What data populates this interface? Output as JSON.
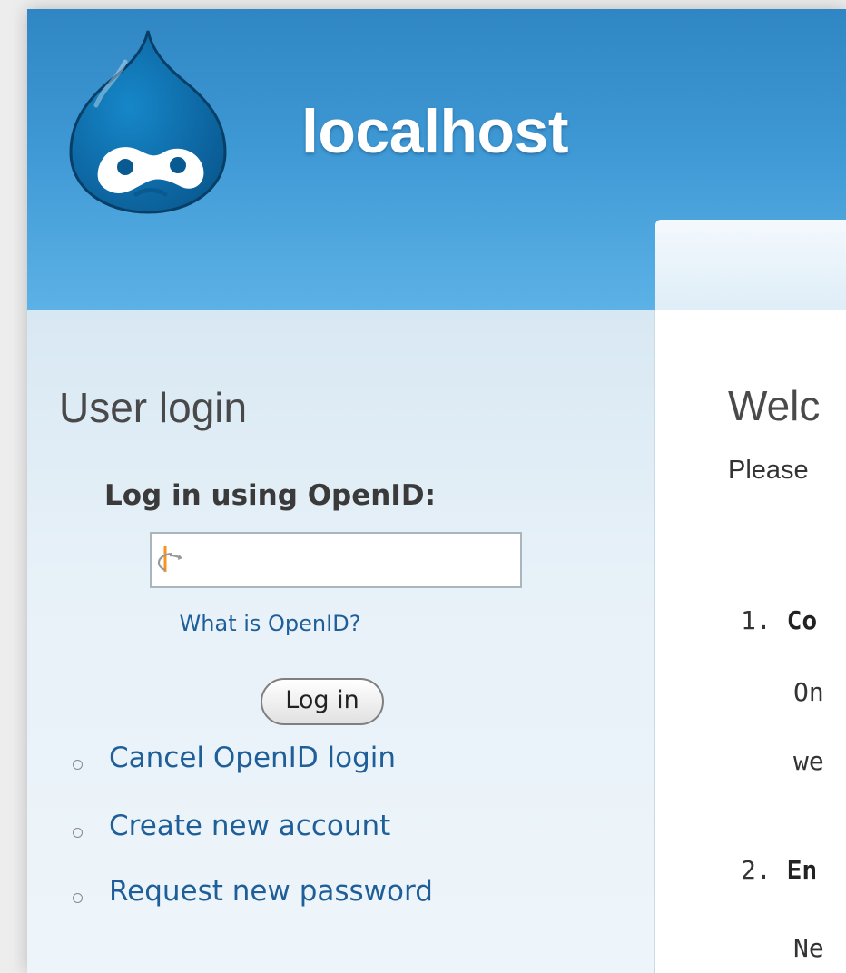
{
  "header": {
    "site_name": "localhost"
  },
  "sidebar": {
    "title": "User login",
    "openid_label": "Log in using OpenID:",
    "openid_value": "",
    "openid_help": "What is OpenID?",
    "login_button": "Log in",
    "links": [
      {
        "label": "Cancel OpenID login"
      },
      {
        "label": "Create new account"
      },
      {
        "label": "Request new password"
      }
    ]
  },
  "main": {
    "title": "Welc",
    "intro": "Please",
    "steps": [
      {
        "number": "1.",
        "title": "Co",
        "lines": [
          "On",
          "we"
        ]
      },
      {
        "number": "2.",
        "title": "En",
        "lines": [
          "Ne"
        ]
      }
    ]
  },
  "colors": {
    "header_blue": "#3e98d4",
    "link_blue": "#1f5f99",
    "sidebar_bg": "#e7f1f8",
    "drupal_logo": "#0a6aa6"
  },
  "icons": {
    "logo": "drupal-drop-logo",
    "openid": "openid-logo",
    "bullet": "hollow-circle"
  }
}
